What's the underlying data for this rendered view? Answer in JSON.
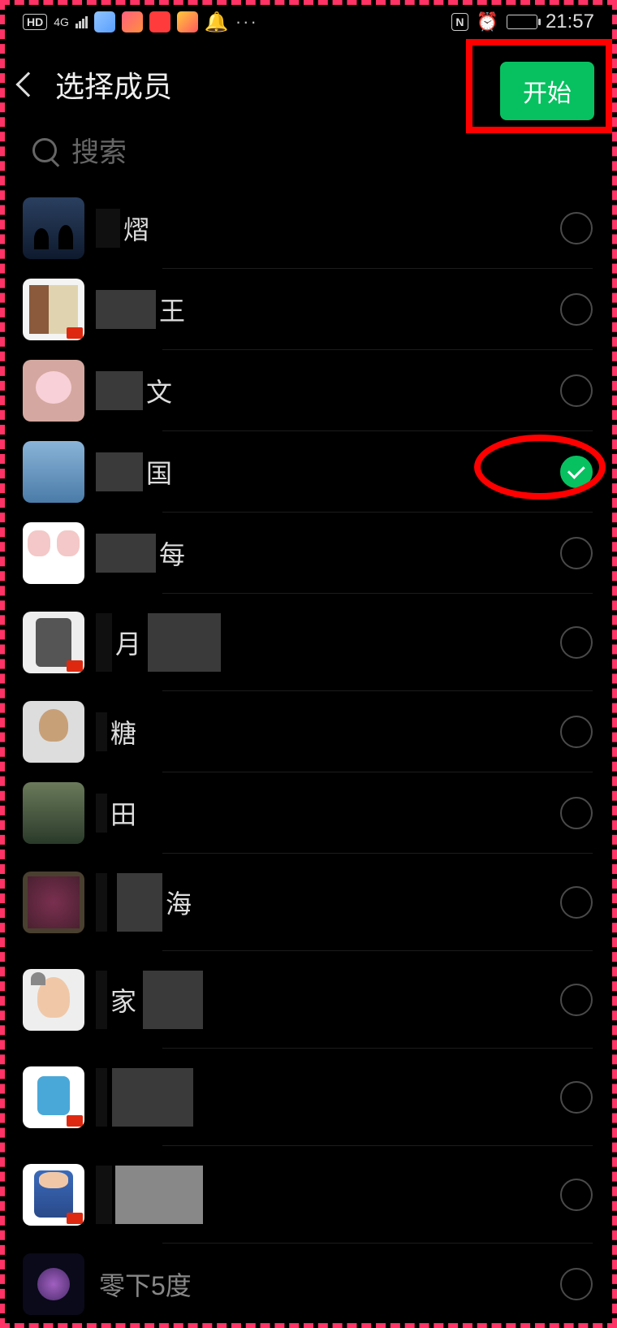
{
  "status": {
    "hd": "HD",
    "network": "4G",
    "nfc": "N",
    "time": "21:57"
  },
  "nav": {
    "title": "选择成员",
    "start_label": "开始"
  },
  "search": {
    "placeholder": "搜索"
  },
  "members": [
    {
      "name_visible": "熠",
      "selected": false,
      "flag": false
    },
    {
      "name_visible": "王",
      "selected": false,
      "flag": true
    },
    {
      "name_visible": "文",
      "selected": false,
      "flag": false
    },
    {
      "name_visible": "国",
      "selected": true,
      "flag": false
    },
    {
      "name_visible": "每",
      "selected": false,
      "flag": false
    },
    {
      "name_visible": "月",
      "selected": false,
      "flag": true
    },
    {
      "name_visible": "糖",
      "selected": false,
      "flag": false
    },
    {
      "name_visible": "田",
      "selected": false,
      "flag": false
    },
    {
      "name_visible": "海",
      "selected": false,
      "flag": false
    },
    {
      "name_visible": "家",
      "selected": false,
      "flag": false
    },
    {
      "name_visible": "",
      "selected": false,
      "flag": true
    },
    {
      "name_visible": "",
      "selected": false,
      "flag": true
    },
    {
      "name_visible": "零下5度",
      "selected": false,
      "flag": false
    }
  ]
}
